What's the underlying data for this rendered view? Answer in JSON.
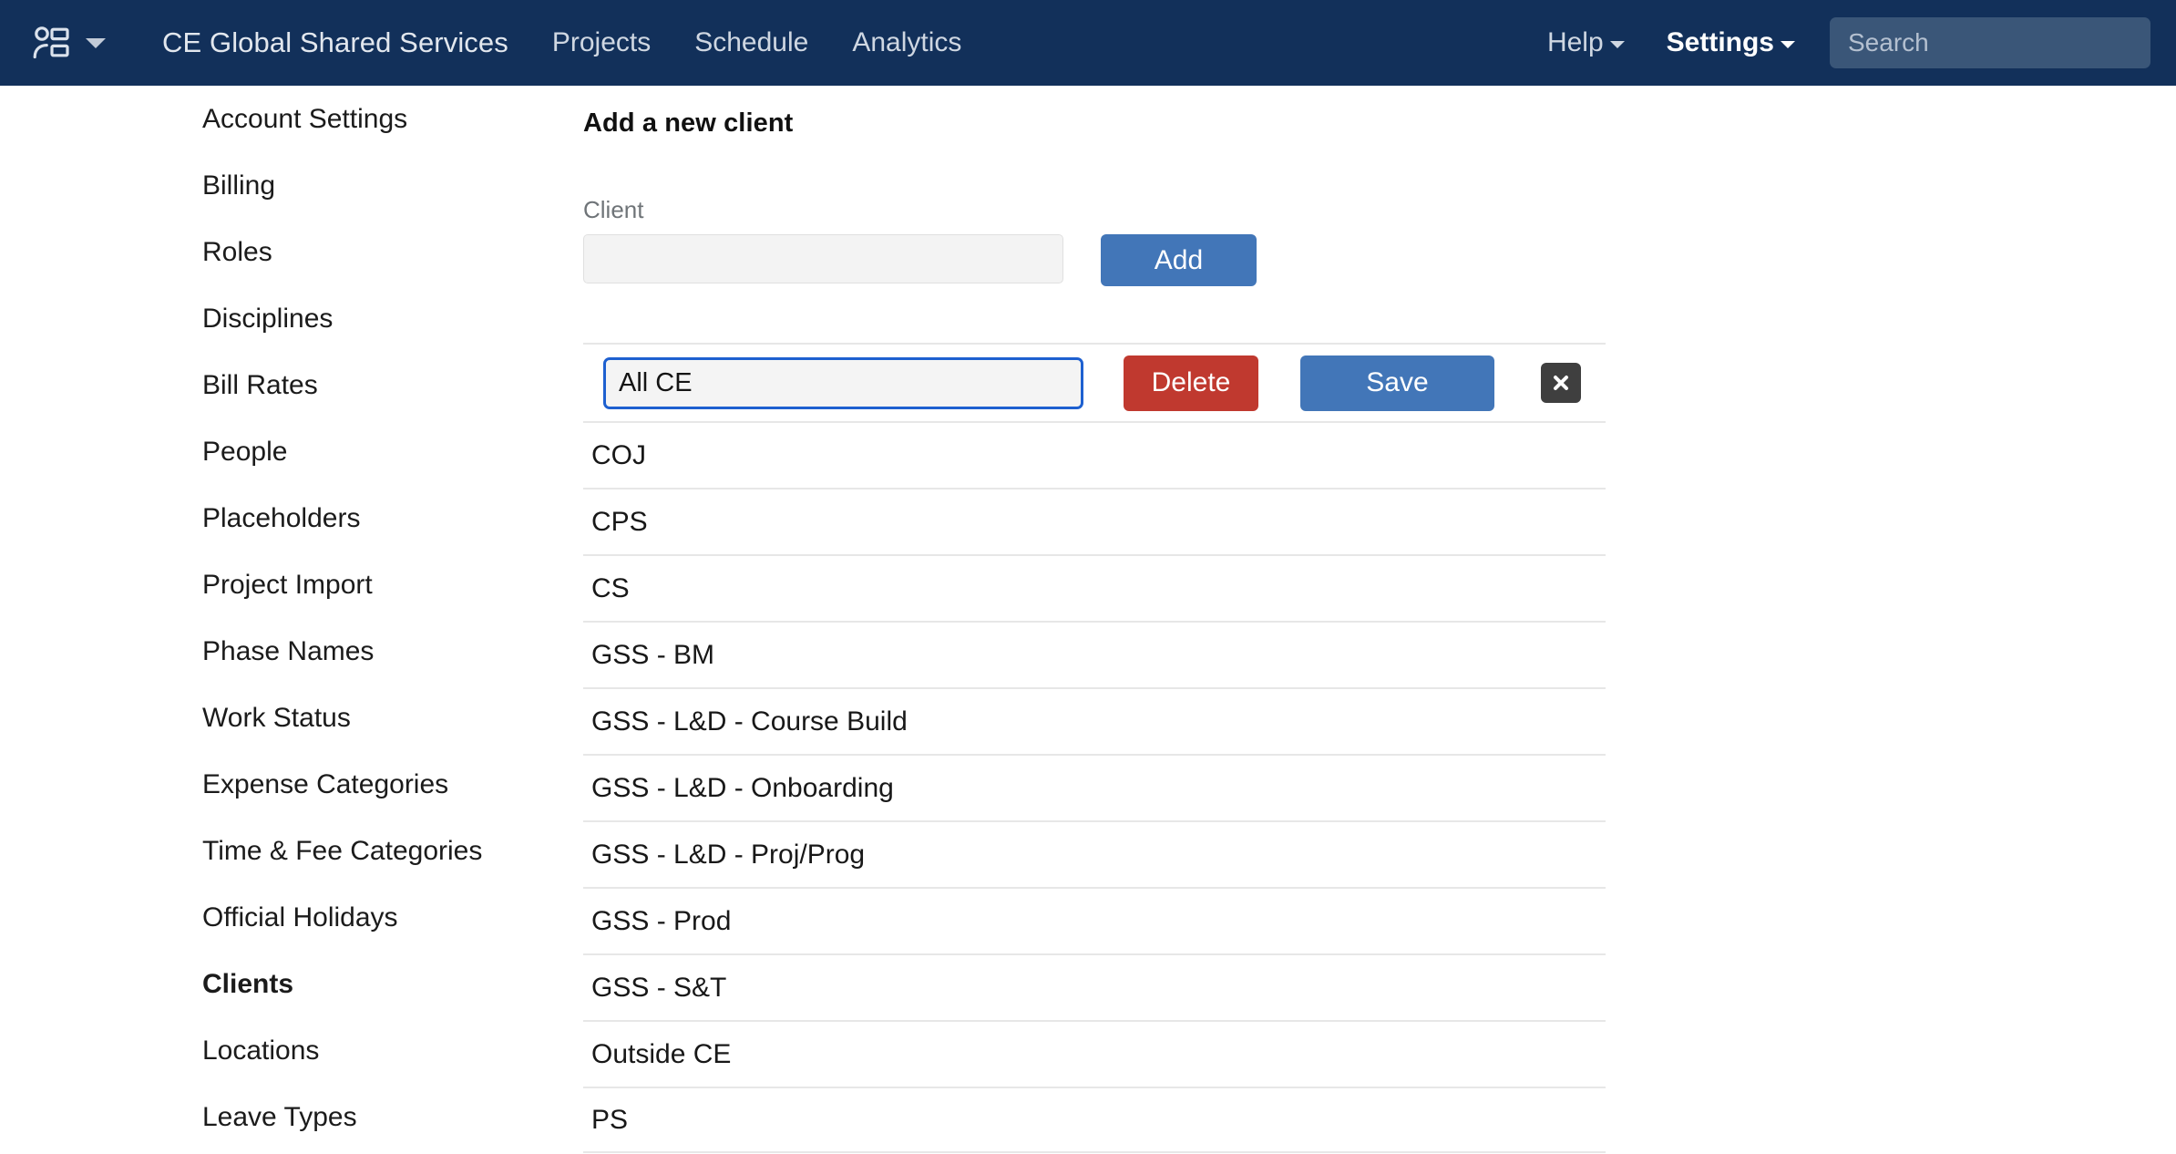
{
  "navbar": {
    "logo_icon": "people-list-icon",
    "logo_caret_icon": "chevron-down-icon",
    "org_name": "CE Global Shared Services",
    "links": [
      {
        "label": "Projects",
        "name": "nav-link-projects"
      },
      {
        "label": "Schedule",
        "name": "nav-link-schedule"
      },
      {
        "label": "Analytics",
        "name": "nav-link-analytics"
      }
    ],
    "help_label": "Help",
    "settings_label": "Settings",
    "search_placeholder": "Search",
    "search_value": "",
    "colors": {
      "navbar_bg": "#12305a",
      "search_bg": "#3a5678",
      "nav_text": "#cfd7e2",
      "active_text": "#ffffff"
    }
  },
  "sidebar": {
    "items": [
      {
        "label": "Account Settings",
        "active": false
      },
      {
        "label": "Billing",
        "active": false
      },
      {
        "label": "Roles",
        "active": false
      },
      {
        "label": "Disciplines",
        "active": false
      },
      {
        "label": "Bill Rates",
        "active": false
      },
      {
        "label": "People",
        "active": false
      },
      {
        "label": "Placeholders",
        "active": false
      },
      {
        "label": "Project Import",
        "active": false
      },
      {
        "label": "Phase Names",
        "active": false
      },
      {
        "label": "Work Status",
        "active": false
      },
      {
        "label": "Expense Categories",
        "active": false
      },
      {
        "label": "Time & Fee Categories",
        "active": false
      },
      {
        "label": "Official Holidays",
        "active": false
      },
      {
        "label": "Clients",
        "active": true
      },
      {
        "label": "Locations",
        "active": false
      },
      {
        "label": "Leave Types",
        "active": false
      }
    ]
  },
  "main": {
    "section_title": "Add a new client",
    "client_field_label": "Client",
    "client_field_value": "",
    "client_field_placeholder": "",
    "add_button_label": "Add",
    "edit_row": {
      "input_value": "All CE",
      "delete_button_label": "Delete",
      "save_button_label": "Save",
      "close_icon": "close-icon"
    },
    "clients": [
      {
        "name": "COJ"
      },
      {
        "name": "CPS"
      },
      {
        "name": "CS"
      },
      {
        "name": "GSS - BM"
      },
      {
        "name": "GSS - L&D - Course Build"
      },
      {
        "name": "GSS - L&D - Onboarding"
      },
      {
        "name": "GSS - L&D - Proj/Prog"
      },
      {
        "name": "GSS - Prod"
      },
      {
        "name": "GSS - S&T"
      },
      {
        "name": "Outside CE"
      },
      {
        "name": "PS"
      }
    ],
    "colors": {
      "primary_button": "#4276b8",
      "danger_button": "#c0392f",
      "close_button": "#3f3f3f",
      "focus_border": "#1e60d0",
      "divider": "#e7e7e7"
    }
  }
}
